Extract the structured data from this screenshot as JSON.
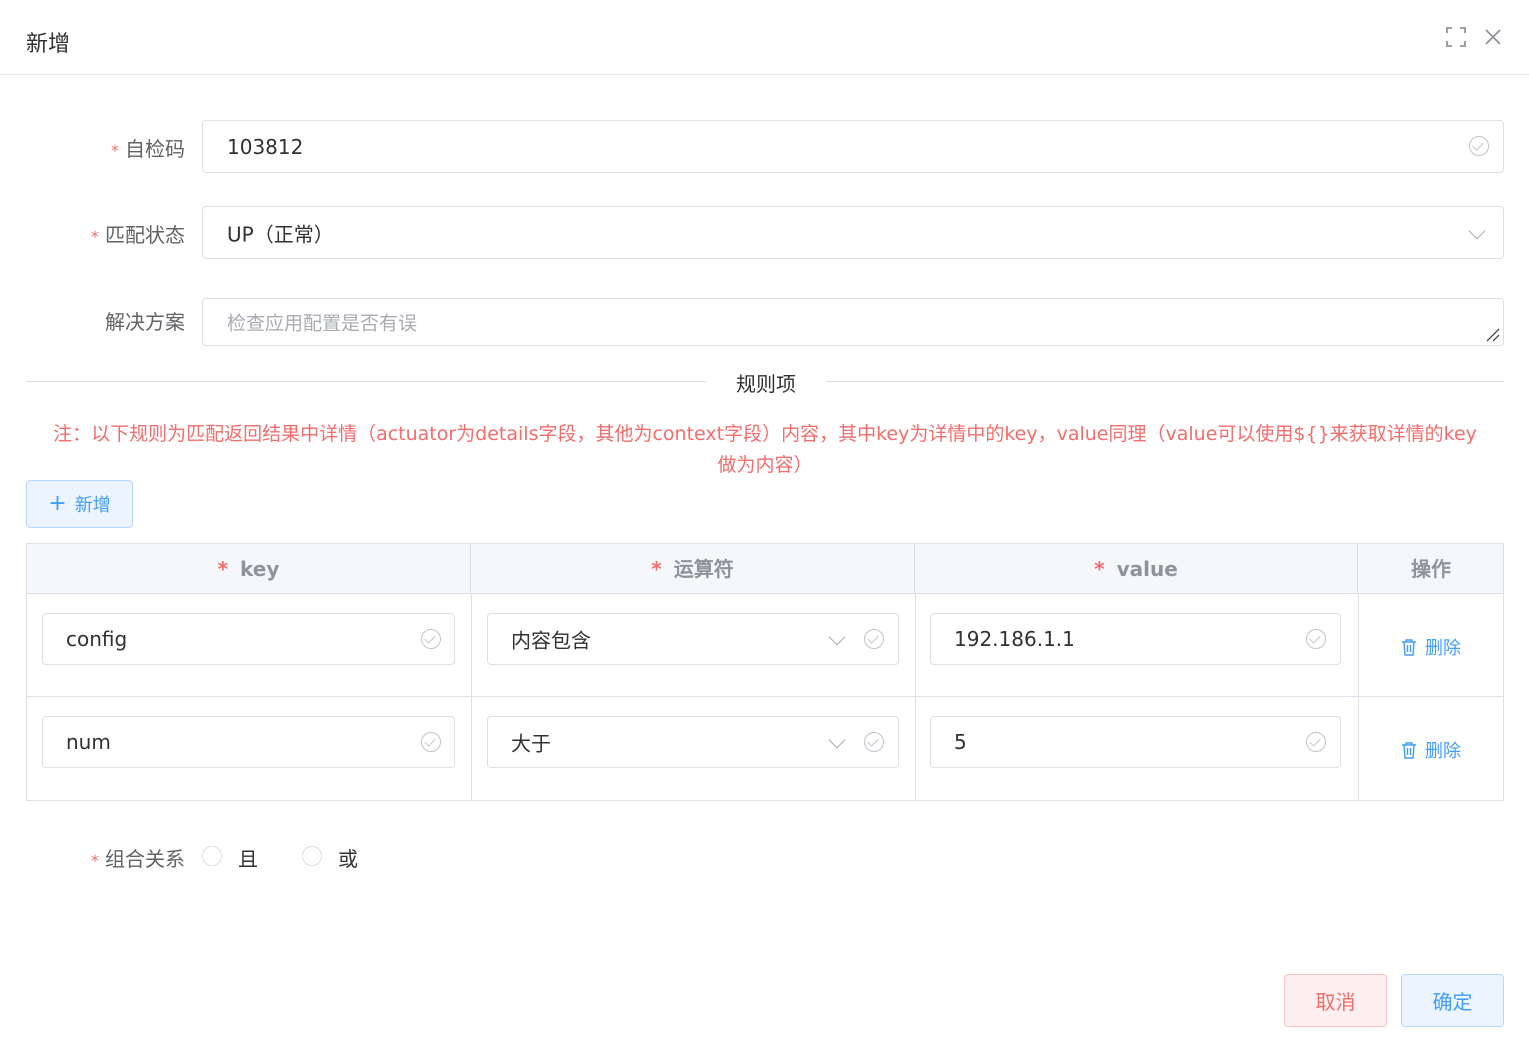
{
  "dialog": {
    "title": "新增"
  },
  "form": {
    "self_check_code": {
      "label": "自检码",
      "value": "103812"
    },
    "match_status": {
      "label": "匹配状态",
      "value": "UP（正常）"
    },
    "solution": {
      "label": "解决方案",
      "placeholder": "检查应用配置是否有误"
    }
  },
  "rules": {
    "divider": "规则项",
    "note_line1": "注：以下规则为匹配返回结果中详情（actuator为details字段，其他为context字段）内容，其中key为详情中的key，value同理（value可以使用${}来获取详情的key",
    "note_line2": "做为内容）",
    "add_label": "新增",
    "columns": {
      "key": "key",
      "operator": "运算符",
      "value": "value",
      "action": "操作"
    },
    "rows": [
      {
        "key": "config",
        "operator": "内容包含",
        "value": "192.186.1.1",
        "delete": "删除"
      },
      {
        "key": "num",
        "operator": "大于",
        "value": "5",
        "delete": "删除"
      }
    ]
  },
  "combination": {
    "label": "组合关系",
    "options": [
      "且",
      "或"
    ]
  },
  "footer": {
    "cancel": "取消",
    "confirm": "确定"
  },
  "colors": {
    "primary": "#409eff",
    "danger": "#f56c6c",
    "border": "#dcdfe6"
  }
}
